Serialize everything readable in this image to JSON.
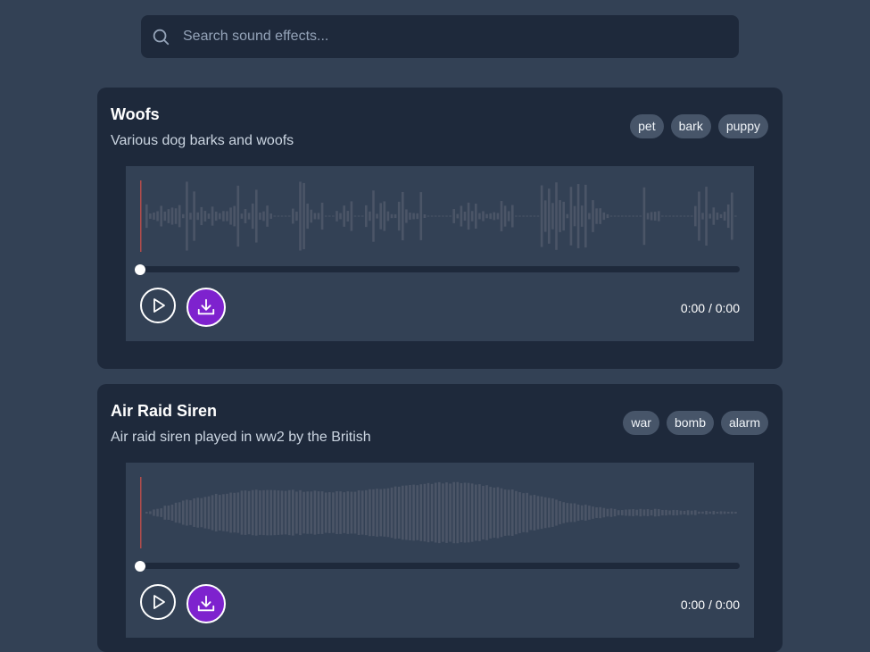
{
  "search": {
    "placeholder": "Search sound effects...",
    "value": ""
  },
  "sounds": [
    {
      "title": "Woofs",
      "description": "Various dog barks and woofs",
      "tags": [
        "pet",
        "bark",
        "puppy"
      ],
      "time": "0:00 / 0:00",
      "progress": 0
    },
    {
      "title": "Air Raid Siren",
      "description": "Air raid siren played in ww2 by the British",
      "tags": [
        "war",
        "bomb",
        "alarm"
      ],
      "time": "0:00 / 0:00",
      "progress": 0
    }
  ],
  "colors": {
    "background": "#334155",
    "card": "#1e293b",
    "tag": "#475569",
    "waveform": "#4b5567",
    "playhead": "#b34c4c",
    "download_button": "#7e22ce"
  },
  "icons": {
    "search": "search-icon",
    "play": "play-icon",
    "download": "download-icon"
  }
}
